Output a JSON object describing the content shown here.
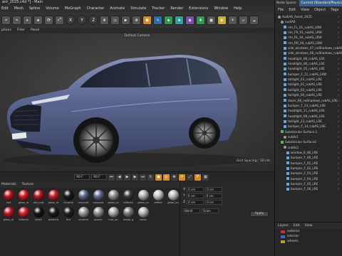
{
  "window": {
    "title": "ent_2025.c4d *] - Main"
  },
  "menubar": [
    "Edit",
    "Mesh",
    "Spline",
    "Volume",
    "MoGraph",
    "Character",
    "Animate",
    "Simulate",
    "Tracker",
    "Render",
    "Extensions",
    "Window",
    "Help"
  ],
  "toolbar": {
    "xyz": [
      "X",
      "Y",
      "Z"
    ]
  },
  "viewport": {
    "menu": [
      "ptions",
      "Filter",
      "Panel"
    ],
    "camera_label": "Default Camera",
    "grid_spacing": "Grid Spacing : 50 cm"
  },
  "timeline": {
    "frame_start": "90 F",
    "frame_end": "90 F"
  },
  "materials": {
    "menu": [
      "Materials",
      "Texture"
    ],
    "items": [
      {
        "name": "red",
        "color": "#c0141c"
      },
      {
        "name": "gloss_re",
        "color": "#d41c24"
      },
      {
        "name": "red_mat",
        "color": "#b81820"
      },
      {
        "name": "gloss_re",
        "color": "#cc2028"
      },
      {
        "name": "chrome",
        "color": "#1a1a1a"
      },
      {
        "name": "carpaint",
        "color": "#5a6a8c"
      },
      {
        "name": "carpaint",
        "color": "#606e90"
      },
      {
        "name": "glass_ca",
        "color": "#909090"
      },
      {
        "name": "reflecto",
        "color": "#3a3a3a"
      },
      {
        "name": "glass_ca",
        "color": "#b0b0b0"
      },
      {
        "name": "reflect",
        "color": "#c4c4c4"
      },
      {
        "name": "glass_bu",
        "color": "#bdbdbd"
      },
      {
        "name": "glass_re",
        "color": "#c01820"
      },
      {
        "name": "reflectb",
        "color": "#d02028"
      },
      {
        "name": "black",
        "color": "#151515"
      },
      {
        "name": "plasticb",
        "color": "#1c1c1c"
      },
      {
        "name": "tire",
        "color": "#222222"
      },
      {
        "name": "chrome",
        "color": "#9a9a9a"
      },
      {
        "name": "plastic",
        "color": "#8e8e8e"
      },
      {
        "name": "mat_an",
        "color": "#a8a8a8"
      },
      {
        "name": "metal_g",
        "color": "#7a7a7a"
      },
      {
        "name": "cover",
        "color": "#b4b4b4"
      }
    ]
  },
  "attributes": {
    "apply_label": "Apply",
    "fields": [
      {
        "label": "X",
        "v1": "0 cm",
        "v2": "0 cm"
      },
      {
        "label": "Y",
        "v1": "0 cm",
        "v2": "0 cm"
      },
      {
        "label": "Z",
        "v1": "0 cm",
        "v2": "0 cm"
      }
    ],
    "mode": "World",
    "scale": "Scale"
  },
  "objects": {
    "header": [
      "Node Space:",
      "Current (Standard/Physical)"
    ],
    "menu": [
      "File",
      "Edit",
      "View",
      "Object",
      "Tags"
    ],
    "items": [
      {
        "name": "AudiA6_Avant_2025",
        "indent": 1,
        "icon": "null"
      },
      {
        "name": "audiA6",
        "indent": 2,
        "icon": "null"
      },
      {
        "name": "rim_FL_01_rubAS_LRW",
        "indent": 3,
        "icon": "poly"
      },
      {
        "name": "rim_FR_01_rubAS_LRW",
        "indent": 3,
        "icon": "poly"
      },
      {
        "name": "rim_RL_04_rubAS_LRW",
        "indent": 3,
        "icon": "poly"
      },
      {
        "name": "rim_RR_04_rubAS_LRW",
        "indent": 3,
        "icon": "poly"
      },
      {
        "name": "side_windows_07_noShadows_rubAS",
        "indent": 3,
        "icon": "poly"
      },
      {
        "name": "side_windows_08_noShadows_rubAS",
        "indent": 3,
        "icon": "poly"
      },
      {
        "name": "headlight_08_rubAS_LRE",
        "indent": 3,
        "icon": "poly"
      },
      {
        "name": "headlight_06_rubAS_LRE",
        "indent": 3,
        "icon": "poly"
      },
      {
        "name": "headlight_05_rubAS_LRE",
        "indent": 3,
        "icon": "poly"
      },
      {
        "name": "bumper_F_11_rubAS_LRW",
        "indent": 3,
        "icon": "poly"
      },
      {
        "name": "taillight_03_rubAS_LRE",
        "indent": 3,
        "icon": "poly"
      },
      {
        "name": "taillight_01_rubAS_LRE",
        "indent": 3,
        "icon": "poly"
      },
      {
        "name": "taillight_02_rubAS_LRE",
        "indent": 3,
        "icon": "poly"
      },
      {
        "name": "taillight_00_rubAS_LRE",
        "indent": 3,
        "icon": "poly"
      },
      {
        "name": "doors_06_noShadows_rubAS_LRE",
        "indent": 3,
        "icon": "poly"
      },
      {
        "name": "bumper_F_23_rubAS_LRE",
        "indent": 3,
        "icon": "poly"
      },
      {
        "name": "headlight_11_rubAS_LRE",
        "indent": 3,
        "icon": "poly"
      },
      {
        "name": "headlight_09_rubAS_LRE",
        "indent": 3,
        "icon": "poly"
      },
      {
        "name": "taillight_23_rubAS_LRE",
        "indent": 3,
        "icon": "poly"
      },
      {
        "name": "bumper_F_14_rubAS_LRE",
        "indent": 3,
        "icon": "poly"
      },
      {
        "name": "Subdivision Surface.1",
        "indent": 2,
        "icon": "green"
      },
      {
        "name": "sub0s1",
        "indent": 3,
        "icon": "null"
      },
      {
        "name": "Subdivision Surface2",
        "indent": 2,
        "icon": "green"
      },
      {
        "name": "sub0s2",
        "indent": 3,
        "icon": "null"
      },
      {
        "name": "window_0_48_LRE",
        "indent": 4,
        "icon": "poly"
      },
      {
        "name": "bumper_F_00_LRE",
        "indent": 4,
        "icon": "poly"
      },
      {
        "name": "bumper_F_01_LRE",
        "indent": 4,
        "icon": "poly"
      },
      {
        "name": "bumper_F_02_LRE",
        "indent": 4,
        "icon": "poly"
      },
      {
        "name": "bumper_F_03_LRE",
        "indent": 4,
        "icon": "poly"
      },
      {
        "name": "bumper_F_04_LRE",
        "indent": 4,
        "icon": "poly"
      },
      {
        "name": "bumper_F_05_LRE",
        "indent": 4,
        "icon": "poly"
      },
      {
        "name": "bumper_F_06_LRE",
        "indent": 4,
        "icon": "poly"
      }
    ]
  },
  "layers": {
    "menu": [
      "Layers",
      "Edit",
      "View"
    ],
    "items": [
      {
        "name": "exterior",
        "color": "#c03030"
      },
      {
        "name": "interior",
        "color": "#3070c0"
      },
      {
        "name": "wheels",
        "color": "#c0a020"
      }
    ]
  }
}
